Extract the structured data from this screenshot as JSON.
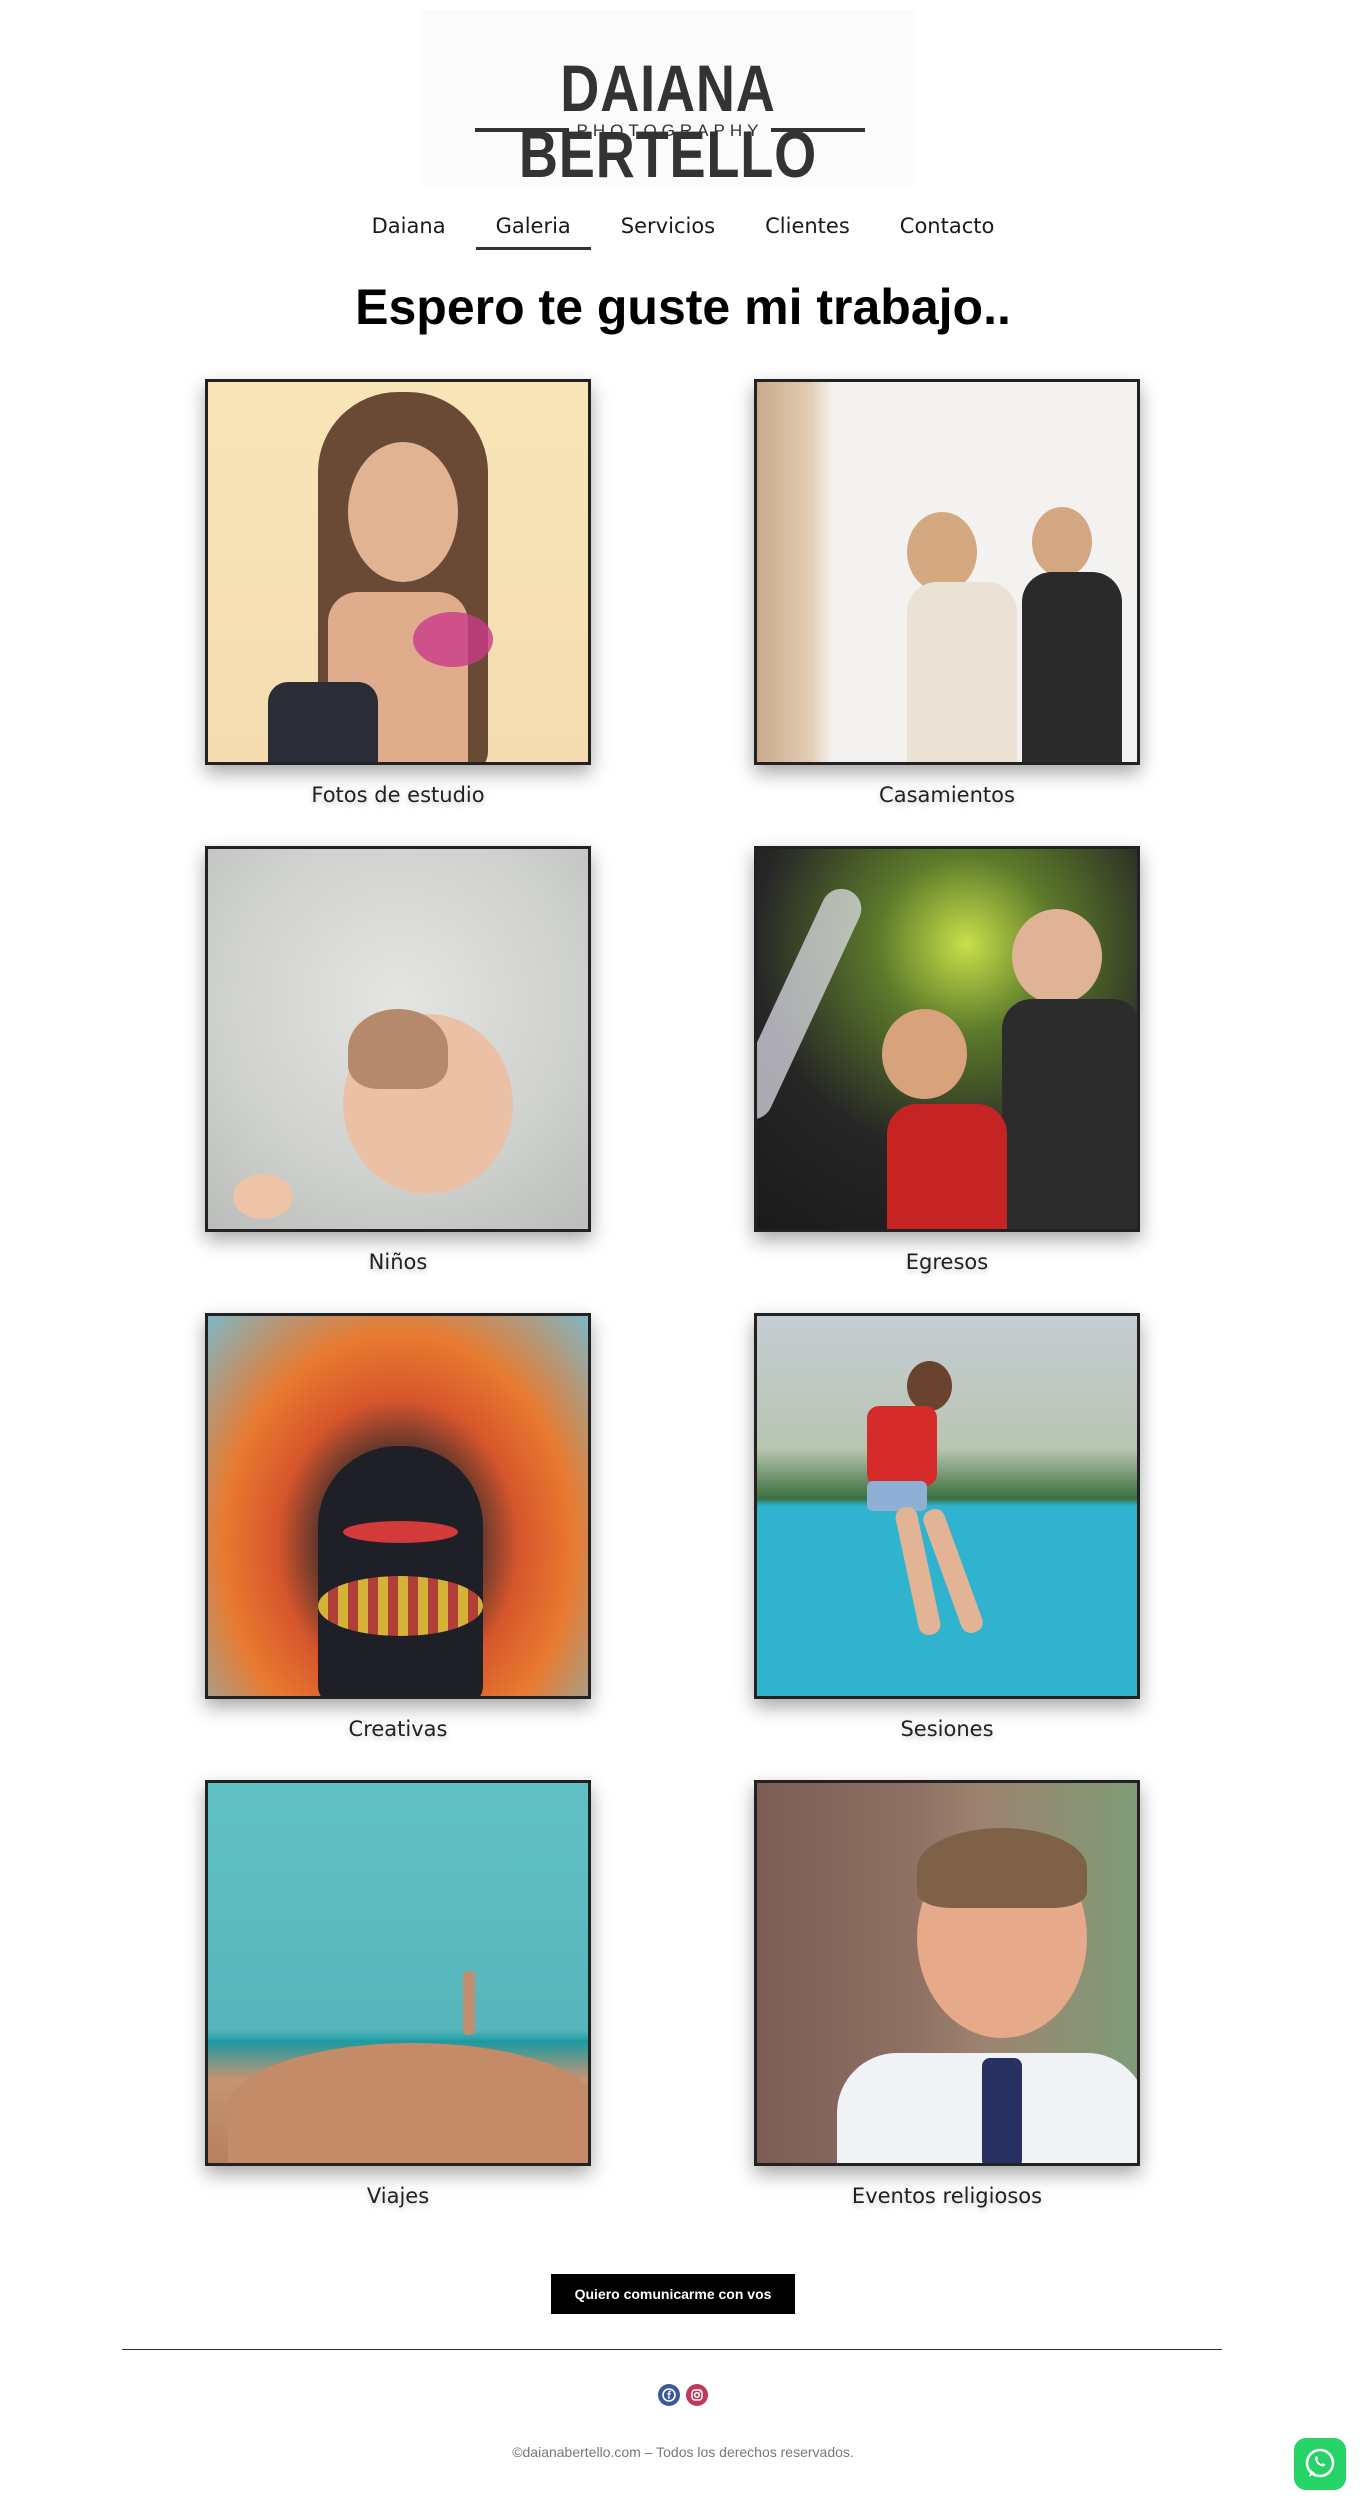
{
  "brand": {
    "logo_main": "DAIANA BERTELLO",
    "logo_sub": "PHOTOGRAPHY"
  },
  "nav": {
    "items": [
      {
        "label": "Daiana"
      },
      {
        "label": "Galeria",
        "active": true
      },
      {
        "label": "Servicios"
      },
      {
        "label": "Clientes"
      },
      {
        "label": "Contacto"
      }
    ]
  },
  "page": {
    "title": "Espero te guste mi trabajo.."
  },
  "gallery": [
    {
      "caption": "Fotos de estudio"
    },
    {
      "caption": "Casamientos"
    },
    {
      "caption": "Niños"
    },
    {
      "caption": "Egresos"
    },
    {
      "caption": "Creativas"
    },
    {
      "caption": "Sesiones"
    },
    {
      "caption": "Viajes"
    },
    {
      "caption": "Eventos religiosos"
    }
  ],
  "cta": {
    "label": "Quiero comunicarme con vos"
  },
  "social": {
    "icons": [
      "facebook-icon",
      "instagram-icon"
    ]
  },
  "footer": {
    "copyright": "©daianabertello.com – Todos los derechos reservados."
  },
  "colors": {
    "button_bg": "#000000",
    "facebook": "#3b5998",
    "instagram": "#c0395b",
    "whatsapp": "#25d366"
  }
}
